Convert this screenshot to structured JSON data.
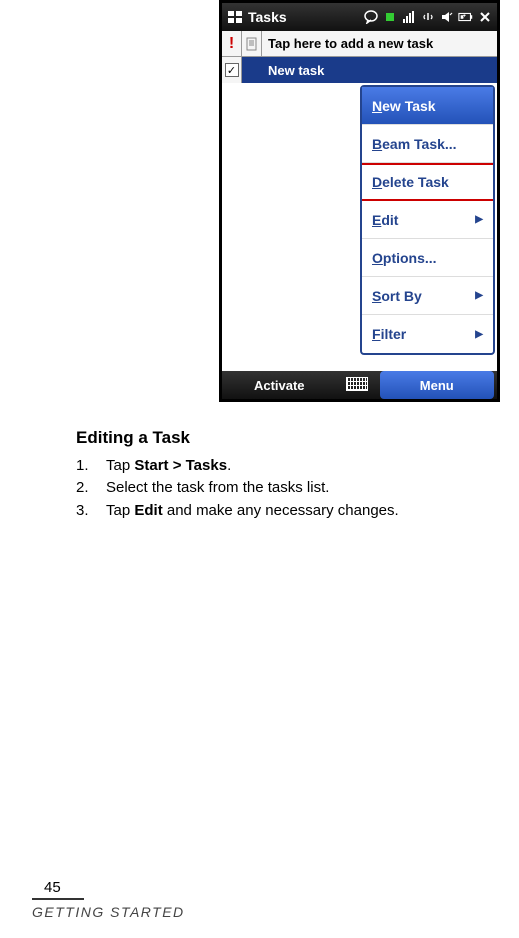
{
  "screenshot": {
    "titlebar": {
      "title": "Tasks",
      "icons": {
        "windows": "⊞",
        "chat": "💬",
        "green": "●",
        "signal": "📶",
        "wifi": "Y",
        "speaker": "🔊",
        "battery": "▭",
        "close": "✕"
      }
    },
    "add_row": {
      "priority": "!",
      "note": "",
      "text": "Tap here to add a new task"
    },
    "task_row": {
      "check": "✓",
      "label": "New task"
    },
    "menu": {
      "items": [
        {
          "label": "New Task",
          "ul": "N",
          "rest": "ew Task",
          "arrow": false,
          "selected": true,
          "delete": false
        },
        {
          "label": "Beam Task...",
          "ul": "B",
          "rest": "eam Task...",
          "arrow": false,
          "selected": false,
          "delete": false
        },
        {
          "label": "Delete Task",
          "ul": "D",
          "rest": "elete Task",
          "arrow": false,
          "selected": false,
          "delete": true
        },
        {
          "label": "Edit",
          "ul": "E",
          "rest": "dit",
          "arrow": true,
          "selected": false,
          "delete": false
        },
        {
          "label": "Options...",
          "ul": "O",
          "rest": "ptions...",
          "arrow": false,
          "selected": false,
          "delete": false
        },
        {
          "label": "Sort By",
          "ul": "S",
          "rest": "ort By",
          "arrow": true,
          "selected": false,
          "delete": false
        },
        {
          "label": "Filter",
          "ul": "F",
          "rest": "ilter",
          "arrow": true,
          "selected": false,
          "delete": false
        }
      ]
    },
    "bottombar": {
      "left": "Activate",
      "right": "Menu"
    }
  },
  "body": {
    "section_title": "Editing a Task",
    "steps": [
      {
        "num": "1.",
        "pre": "Tap ",
        "bold": "Start > Tasks",
        "post": "."
      },
      {
        "num": "2.",
        "pre": "Select the task from the tasks list.",
        "bold": "",
        "post": ""
      },
      {
        "num": "3.",
        "pre": "Tap ",
        "bold": "Edit",
        "post": " and make any necessary changes."
      }
    ]
  },
  "footer": {
    "page_num": "45",
    "label": "Getting Started"
  }
}
